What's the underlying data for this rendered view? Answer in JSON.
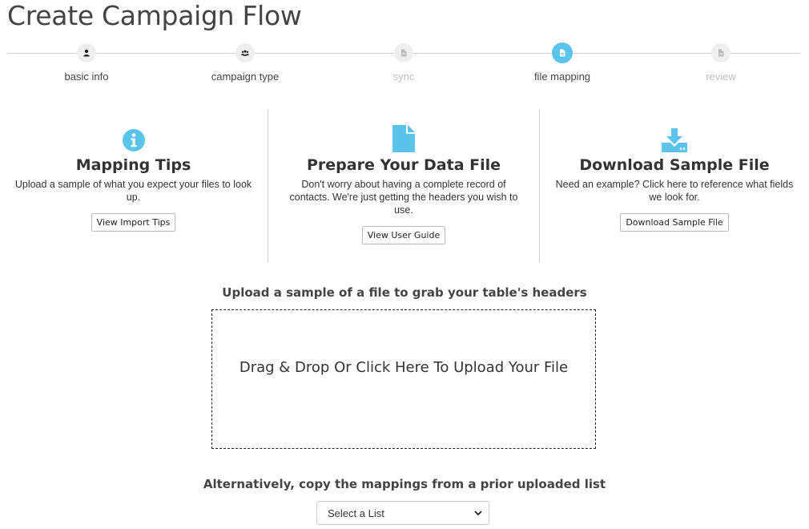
{
  "page": {
    "title": "Create Campaign Flow"
  },
  "stepper": {
    "steps": [
      {
        "label": "basic info",
        "icon": "user-icon",
        "state": "complete"
      },
      {
        "label": "campaign type",
        "icon": "users-icon",
        "state": "complete"
      },
      {
        "label": "sync",
        "icon": "file-icon",
        "state": "disabled"
      },
      {
        "label": "file mapping",
        "icon": "file-icon",
        "state": "active"
      },
      {
        "label": "review",
        "icon": "file-icon",
        "state": "disabled"
      }
    ]
  },
  "info": {
    "tips": {
      "icon": "info-icon",
      "title": "Mapping Tips",
      "description": "Upload a sample of what you expect your files to look up.",
      "button": "View Import Tips"
    },
    "prepare": {
      "icon": "document-icon",
      "title": "Prepare Your Data File",
      "description": "Don't worry about having a complete record of contacts. We're just getting the headers you wish to use.",
      "button": "View User Guide"
    },
    "download": {
      "icon": "download-icon",
      "title": "Download Sample File",
      "description": "Need an example? Click here to reference what fields we look for.",
      "button": "Download Sample File"
    }
  },
  "upload": {
    "heading": "Upload a sample of a file to grab your table's headers",
    "dropzone_text": "Drag & Drop Or Click Here To Upload Your File"
  },
  "alternative": {
    "heading": "Alternatively, copy the mappings from a prior uploaded list",
    "select_value": "Select a List"
  },
  "colors": {
    "accent": "#5bc4ea",
    "text": "#333333",
    "muted": "#bdbdbd"
  }
}
